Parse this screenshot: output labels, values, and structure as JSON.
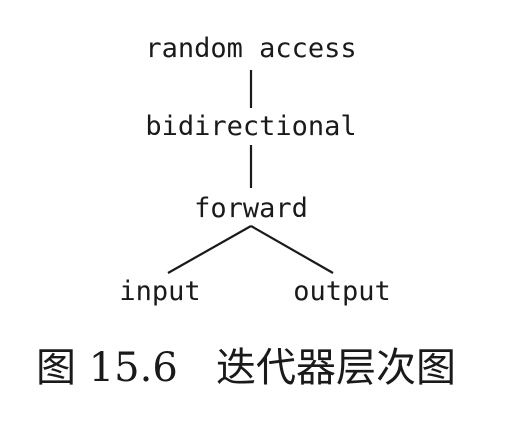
{
  "nodes": {
    "random_access": "random access",
    "bidirectional": "bidirectional",
    "forward": "forward",
    "input": "input",
    "output": "output"
  },
  "caption": {
    "number": "图 15.6",
    "title": "迭代器层次图"
  }
}
